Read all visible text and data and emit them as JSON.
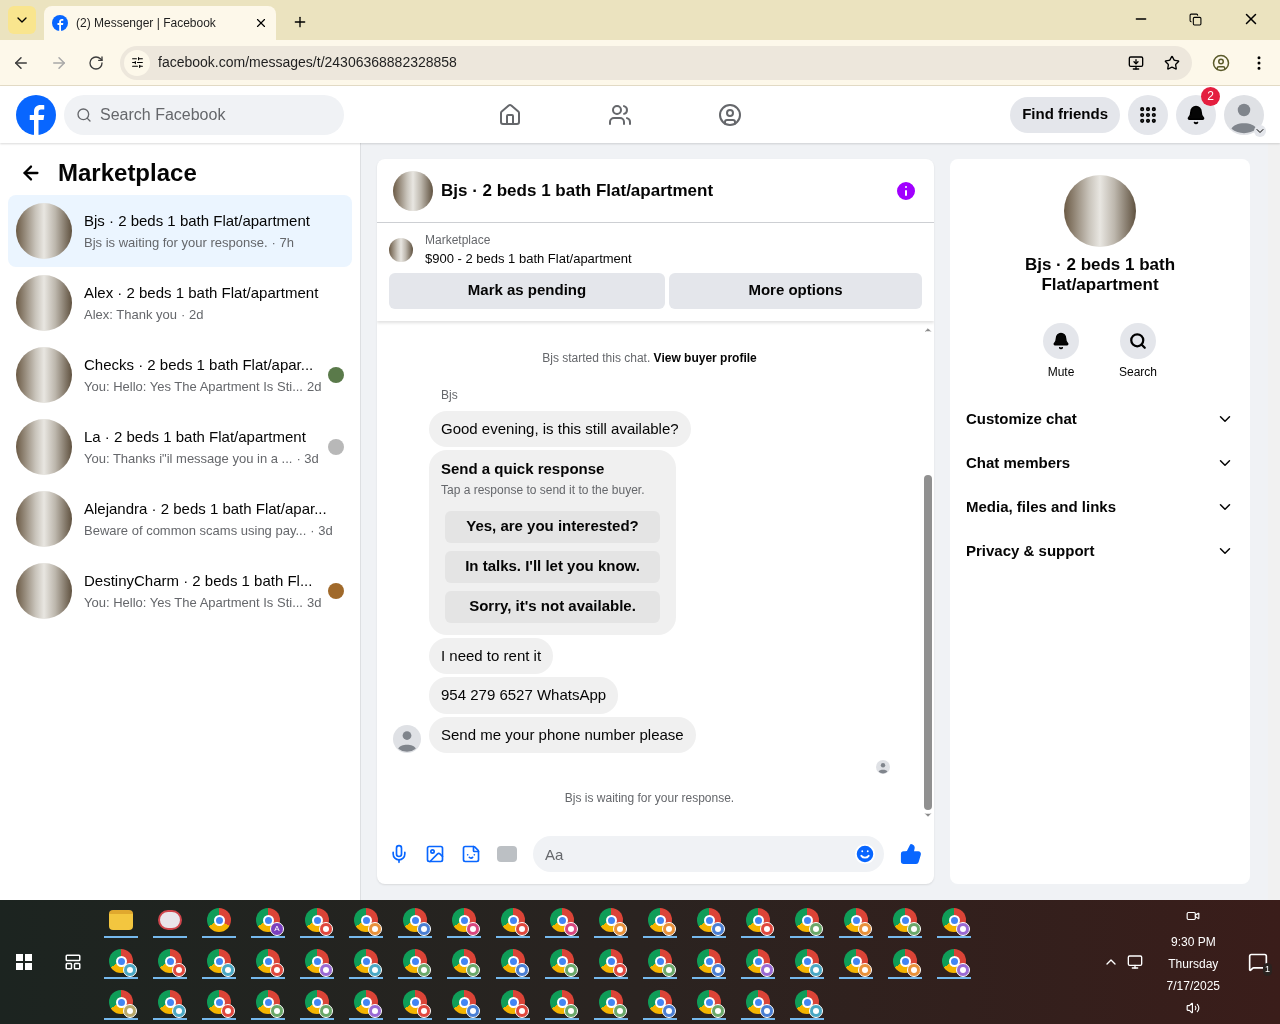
{
  "browser": {
    "tab_title": "(2) Messenger | Facebook",
    "url": "facebook.com/messages/t/24306368882328858"
  },
  "header": {
    "search_placeholder": "Search Facebook",
    "find_friends": "Find friends",
    "notification_count": "2"
  },
  "sidebar": {
    "title": "Marketplace",
    "conversations": [
      {
        "title": "Bjs · 2 beds 1 bath Flat/apartment",
        "preview": "Bjs is waiting for your response.",
        "time": "· 7h",
        "selected": true,
        "read_receipt": false
      },
      {
        "title": "Alex · 2 beds 1 bath Flat/apartment",
        "preview": "Alex: Thank you",
        "time": "· 2d",
        "selected": false,
        "read_receipt": false
      },
      {
        "title": "Checks · 2 beds 1 bath Flat/apar...",
        "preview": "You: Hello: Yes The Apartment Is Sti...",
        "time": "2d",
        "selected": false,
        "read_receipt": true,
        "color": "#5a7a4a"
      },
      {
        "title": "La · 2 beds 1 bath Flat/apartment",
        "preview": "You: Thanks i\"il message you in a ...",
        "time": "· 3d",
        "selected": false,
        "read_receipt": true,
        "color": "#b8b8b8"
      },
      {
        "title": "Alejandra · 2 beds 1 bath Flat/apar...",
        "preview": "Beware of common scams using pay...",
        "time": "· 3d",
        "selected": false,
        "read_receipt": false
      },
      {
        "title": "DestinyCharm · 2 beds 1 bath Fl...",
        "preview": "You: Hello: Yes The Apartment Is Sti...",
        "time": "3d",
        "selected": false,
        "read_receipt": true,
        "color": "#a0692a"
      }
    ]
  },
  "chat": {
    "title": "Bjs · 2 beds 1 bath Flat/apartment",
    "listing_label": "Marketplace",
    "listing_text": "$900 - 2 beds 1 bath Flat/apartment",
    "buttons": [
      "Mark as pending",
      "More options"
    ],
    "started_text": "Bjs started this chat.",
    "started_link": "View buyer profile",
    "sender": "Bjs",
    "messages": [
      {
        "kind": "text",
        "text": "Good evening, is this still available?",
        "show_avatar": false
      },
      {
        "kind": "quick",
        "title": "Send a quick response",
        "subtitle": "Tap a response to send it to the buyer.",
        "options": [
          "Yes, are you interested?",
          "In talks. I'll let you know.",
          "Sorry, it's not available."
        ],
        "show_avatar": false
      },
      {
        "kind": "text",
        "text": "I need to rent it",
        "show_avatar": false
      },
      {
        "kind": "text",
        "text": "954 279 6527 WhatsApp",
        "show_avatar": false
      },
      {
        "kind": "text",
        "text": "Send me your phone number please",
        "show_avatar": true
      }
    ],
    "status": "Bjs is waiting for your response.",
    "composer_placeholder": "Aa"
  },
  "info": {
    "title": "Bjs · 2 beds 1 bath Flat/apartment",
    "actions": [
      {
        "kind": "bell",
        "label": "Mute"
      },
      {
        "kind": "search",
        "label": "Search"
      }
    ],
    "sections": [
      {
        "label": "Customize chat",
        "expanded": false
      },
      {
        "label": "Chat members",
        "expanded": false
      },
      {
        "label": "Media, files and links",
        "expanded": false
      },
      {
        "label": "Privacy & support",
        "expanded": false
      }
    ]
  },
  "taskbar": {
    "time": "9:30 PM",
    "day": "Thursday",
    "date": "7/17/2025",
    "notification_count": "1",
    "apps": [
      {
        "kind": "folder"
      },
      {
        "kind": "snip"
      },
      {
        "kind": "chrome"
      },
      {
        "kind": "profile",
        "color": "#7b3fbf",
        "letter": "A"
      },
      {
        "kind": "profile",
        "color": "#e0483e"
      },
      {
        "kind": "profile",
        "color": "#e8913a"
      },
      {
        "kind": "profile",
        "color": "#4a7fd4"
      },
      {
        "kind": "profile",
        "color": "#d9477f"
      },
      {
        "kind": "profile",
        "color": "#e0483e"
      },
      {
        "kind": "profile",
        "color": "#d9477f"
      },
      {
        "kind": "profile",
        "color": "#e8913a"
      },
      {
        "kind": "profile",
        "color": "#e8913a"
      },
      {
        "kind": "profile",
        "color": "#4a7fd4"
      },
      {
        "kind": "profile",
        "color": "#e0483e"
      },
      {
        "kind": "profile",
        "color": "#6aa86a"
      },
      {
        "kind": "profile",
        "color": "#e8913a"
      },
      {
        "kind": "profile",
        "color": "#6aa86a"
      },
      {
        "kind": "profile",
        "color": "#9a6ad4"
      },
      {
        "kind": "profile",
        "color": "#4aa8c4"
      },
      {
        "kind": "profile",
        "color": "#e0483e"
      },
      {
        "kind": "profile",
        "color": "#4aa8c4"
      },
      {
        "kind": "profile",
        "color": "#e0483e"
      },
      {
        "kind": "profile",
        "color": "#9a6ad4"
      },
      {
        "kind": "profile",
        "color": "#4aa8c4"
      },
      {
        "kind": "profile",
        "color": "#6aa86a"
      },
      {
        "kind": "profile",
        "color": "#6aa86a"
      },
      {
        "kind": "profile",
        "color": "#4a7fd4"
      },
      {
        "kind": "profile",
        "color": "#6aa86a"
      },
      {
        "kind": "profile",
        "color": "#e0483e"
      },
      {
        "kind": "profile",
        "color": "#6aa86a"
      },
      {
        "kind": "profile",
        "color": "#4a7fd4"
      },
      {
        "kind": "profile",
        "color": "#9a6ad4"
      },
      {
        "kind": "profile",
        "color": "#4aa8c4"
      },
      {
        "kind": "profile",
        "color": "#e8913a"
      },
      {
        "kind": "profile",
        "color": "#e8913a"
      },
      {
        "kind": "profile",
        "color": "#9a6ad4"
      },
      {
        "kind": "profile",
        "color": "#b8a86a"
      },
      {
        "kind": "profile",
        "color": "#4aa8c4"
      },
      {
        "kind": "profile",
        "color": "#e0483e"
      },
      {
        "kind": "profile",
        "color": "#6aa86a"
      },
      {
        "kind": "profile",
        "color": "#6aa86a"
      },
      {
        "kind": "profile",
        "color": "#9a6ad4"
      },
      {
        "kind": "profile",
        "color": "#e0483e"
      },
      {
        "kind": "profile",
        "color": "#4a7fd4"
      },
      {
        "kind": "profile",
        "color": "#e0483e"
      },
      {
        "kind": "profile",
        "color": "#6aa86a"
      },
      {
        "kind": "profile",
        "color": "#6aa86a"
      },
      {
        "kind": "profile",
        "color": "#4a7fd4"
      },
      {
        "kind": "profile",
        "color": "#6aa86a"
      },
      {
        "kind": "profile",
        "color": "#4a7fd4"
      },
      {
        "kind": "profile",
        "color": "#4aa8c4"
      }
    ]
  }
}
